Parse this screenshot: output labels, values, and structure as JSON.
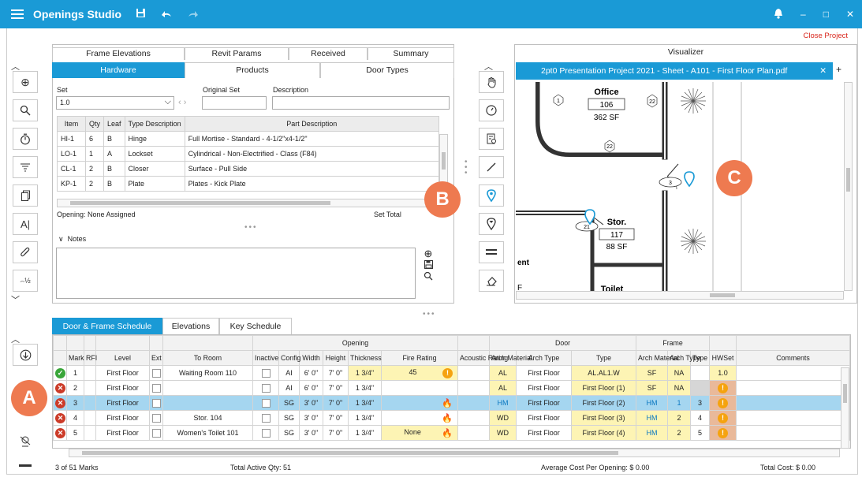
{
  "title_bar": {
    "app_title": "Openings Studio",
    "close_project": "Close Project",
    "bg_color": "#1a9ad6"
  },
  "left_tools": {
    "upper": [
      "add-icon",
      "search-icon",
      "timer-icon",
      "filter-icon",
      "copy-icon",
      "text-icon",
      "attach-icon",
      "sort-numeric-icon"
    ],
    "lower": [
      "download-icon",
      "location-off-icon",
      "dash-icon"
    ]
  },
  "hardware": {
    "tabs_row1": [
      "Frame Elevations",
      "Revit Params",
      "Received",
      "Summary"
    ],
    "tabs_row2": [
      "Hardware",
      "Products",
      "Door Types"
    ],
    "set_label": "Set",
    "set_value": "1.0",
    "original_set_label": "Original Set",
    "description_label": "Description",
    "columns": [
      "Item",
      "Qty",
      "Leaf",
      "Type Description",
      "Part Description"
    ],
    "rows": [
      [
        "HI-1",
        "6",
        "B",
        "Hinge",
        "Full Mortise - Standard - 4-1/2\"x4-1/2\""
      ],
      [
        "LO-1",
        "1",
        "A",
        "Lockset",
        "Cylindrical - Non-Electrified - Class (F84)"
      ],
      [
        "CL-1",
        "2",
        "B",
        "Closer",
        "Surface - Pull Side"
      ],
      [
        "KP-1",
        "2",
        "B",
        "Plate",
        "Plates - Kick Plate"
      ]
    ],
    "opening_label": "Opening: None Assigned",
    "set_total_label": "Set Total",
    "notes_label": "Notes"
  },
  "visualizer": {
    "header": "Visualizer",
    "tab_title": "2pt0 Presentation Project 2021 - Sheet - A101 - First Floor Plan.pdf",
    "tab_close": "✕",
    "tab_add": "+",
    "rooms": [
      {
        "name": "Office",
        "number": "106",
        "area": "362 SF"
      },
      {
        "name": "Stor.",
        "number": "117",
        "area": "88 SF"
      },
      {
        "name": "Toilet",
        "number": "",
        "area": ""
      }
    ],
    "tags": [
      "1",
      "22",
      "22",
      "3",
      "21"
    ],
    "cut_text_1": "ent",
    "cut_text_2": "F"
  },
  "schedule": {
    "tabs": [
      "Door & Frame Schedule",
      "Elevations",
      "Key Schedule"
    ],
    "group_headers": {
      "opening": "Opening",
      "door": "Door",
      "frame": "Frame"
    },
    "columns": [
      "Mark",
      "RFI",
      "Level",
      "Ext",
      "To Room",
      "Inactive",
      "Config",
      "Width",
      "Height",
      "Thickness",
      "Fire Rating",
      "Acoustic Rating",
      "Arch Material",
      "Arch Type",
      "Type",
      "Arch Material",
      "Arch Type",
      "Type",
      "HWSet",
      "Comments"
    ],
    "rows": [
      {
        "status": "ok",
        "mark": "1",
        "level": "First Floor",
        "room": "Waiting Room 110",
        "config": "AI",
        "width": "6' 0\"",
        "height": "7' 0\"",
        "thick": "1 3/4\"",
        "fire": "45",
        "door_mat": "AL",
        "door_arch": "First Floor",
        "door_type": "AL.AL1.W",
        "frame_mat": "SF",
        "frame_arch": "NA",
        "frame_type": "",
        "hwset": "1.0"
      },
      {
        "status": "err",
        "mark": "2",
        "level": "First Floor",
        "room": "",
        "config": "AI",
        "width": "6' 0\"",
        "height": "7' 0\"",
        "thick": "1 3/4\"",
        "fire": "",
        "door_mat": "AL",
        "door_arch": "First Floor",
        "door_type": "First Floor (1)",
        "frame_mat": "SF",
        "frame_arch": "NA",
        "frame_type": "",
        "hwset": ""
      },
      {
        "status": "err",
        "mark": "3",
        "level": "First Floor",
        "room": "",
        "config": "SG",
        "width": "3' 0\"",
        "height": "7' 0\"",
        "thick": "1 3/4\"",
        "fire": "",
        "door_mat": "HM",
        "door_arch": "First Floor",
        "door_type": "First Floor (2)",
        "frame_mat": "HM",
        "frame_arch": "1",
        "frame_type": "3",
        "hwset": ""
      },
      {
        "status": "err",
        "mark": "4",
        "level": "First Floor",
        "room": "Stor. 104",
        "config": "SG",
        "width": "3' 0\"",
        "height": "7' 0\"",
        "thick": "1 3/4\"",
        "fire": "",
        "door_mat": "WD",
        "door_arch": "First Floor",
        "door_type": "First Floor (3)",
        "frame_mat": "HM",
        "frame_arch": "2",
        "frame_type": "4",
        "hwset": ""
      },
      {
        "status": "err",
        "mark": "5",
        "level": "First Floor",
        "room": "Women's Toilet 101",
        "config": "SG",
        "width": "3' 0\"",
        "height": "7' 0\"",
        "thick": "1 3/4\"",
        "fire": "None",
        "door_mat": "WD",
        "door_arch": "First Floor",
        "door_type": "First Floor (4)",
        "frame_mat": "HM",
        "frame_arch": "2",
        "frame_type": "5",
        "hwset": ""
      }
    ],
    "footer": {
      "marks": "3 of 51 Marks",
      "active": "Total Active Qty: 51",
      "avg": "Average Cost Per Opening: $  0.00",
      "total": "Total Cost: $  0.00"
    }
  },
  "callouts": [
    "A",
    "B",
    "C"
  ]
}
